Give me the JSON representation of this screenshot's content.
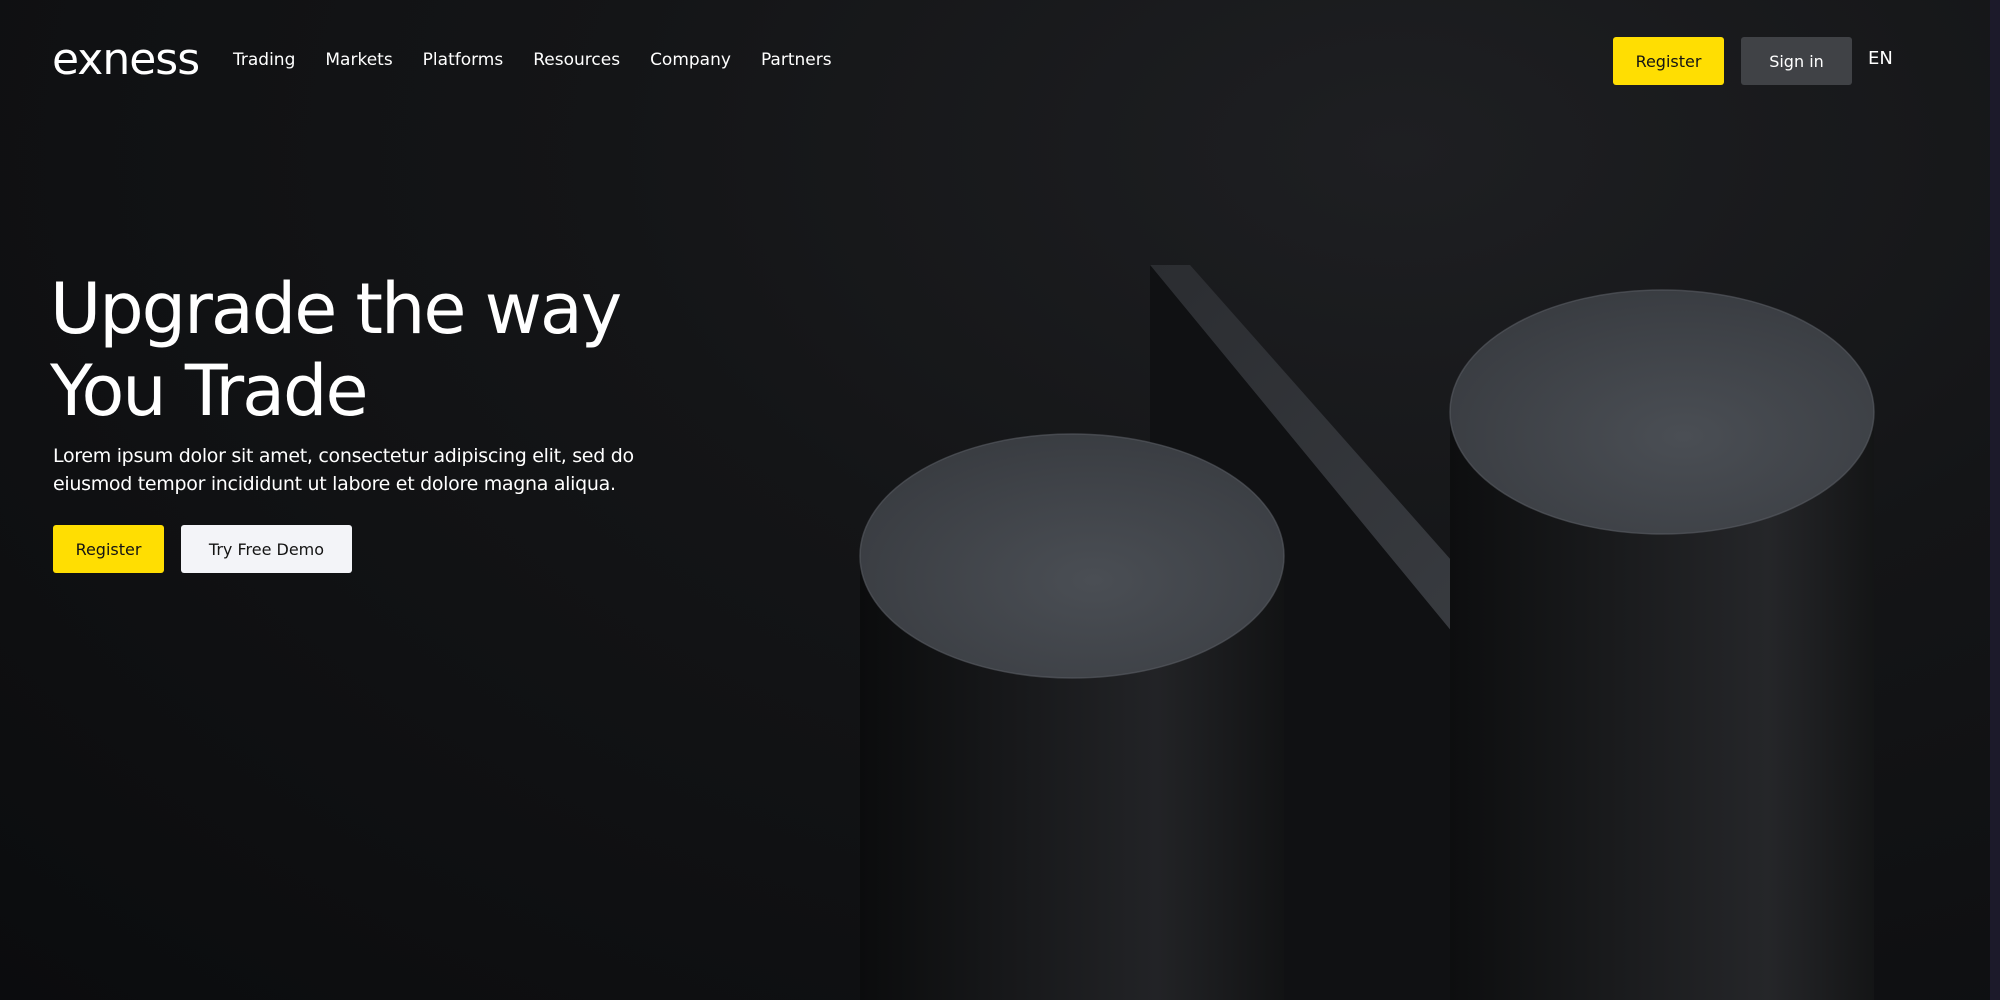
{
  "header": {
    "logo_text": "exness",
    "nav_items": [
      "Trading",
      "Markets",
      "Platforms",
      "Resources",
      "Company",
      "Partners"
    ],
    "register_label": "Register",
    "signin_label": "Sign in",
    "language": "EN"
  },
  "hero": {
    "title_line1": "Upgrade the way",
    "title_line2": "You Trade",
    "description": "Lorem ipsum dolor sit amet, consectetur adipiscing elit, sed do eiusmod tempor incididunt ut labore et dolore magna aliqua.",
    "register_label": "Register",
    "demo_label": "Try Free Demo"
  },
  "colors": {
    "accent": "#ffde02",
    "background": "#0c0d0f",
    "signin_bg": "#404246",
    "demo_bg": "#f3f4f8"
  }
}
